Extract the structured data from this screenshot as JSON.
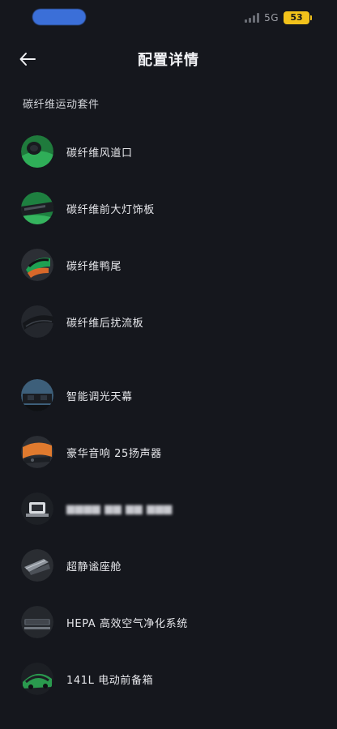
{
  "status_bar": {
    "network": "5G",
    "battery": "53"
  },
  "header": {
    "title": "配置详情"
  },
  "section": {
    "title": "碳纤维运动套件"
  },
  "items": [
    {
      "label": "碳纤维风道口",
      "thumb": "air-vent-thumb"
    },
    {
      "label": "碳纤维前大灯饰板",
      "thumb": "headlight-trim-thumb"
    },
    {
      "label": "碳纤维鸭尾",
      "thumb": "ducktail-thumb"
    },
    {
      "label": "碳纤维后扰流板",
      "thumb": "rear-spoiler-thumb"
    },
    {
      "label": "智能调光天幕",
      "thumb": "smart-sunroof-thumb"
    },
    {
      "label": "豪华音响 25扬声器",
      "thumb": "speaker-thumb"
    },
    {
      "label": "▆▆▆▆ ▆▆ ▆▆ ▆▆▆",
      "thumb": "blurred-feature-thumb"
    },
    {
      "label": "超静谧座舱",
      "thumb": "quiet-cabin-thumb"
    },
    {
      "label": "HEPA 高效空气净化系统",
      "thumb": "air-purifier-thumb"
    },
    {
      "label": "141L 电动前备箱",
      "thumb": "front-trunk-thumb"
    }
  ]
}
